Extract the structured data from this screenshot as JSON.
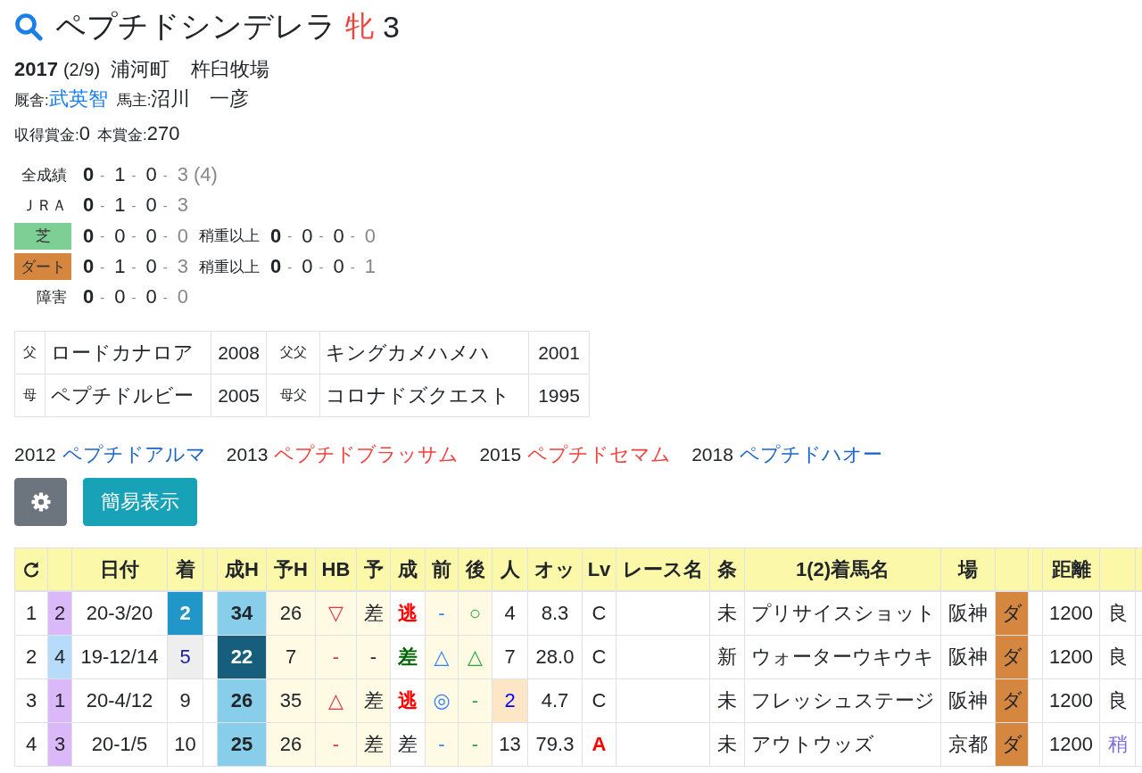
{
  "horse": {
    "name": "ペプチドシンデレラ",
    "sex": "牝",
    "age": "3"
  },
  "profile": {
    "birth_year": "2017",
    "birth_date": "(2/9)",
    "birthplace": "浦河町",
    "breeder": "杵臼牧場",
    "trainer_label": "厩舎:",
    "trainer": "武英智",
    "owner_label": "馬主:",
    "owner": "沼川　一彦",
    "prizes": [
      {
        "label": "収得賞金:",
        "value": "0"
      },
      {
        "label": "本賞金:",
        "value": "270"
      }
    ]
  },
  "records": [
    {
      "label": "全成績",
      "kind": "plain",
      "counts": [
        "0",
        "1",
        "0",
        "3"
      ],
      "separator": "-",
      "total": "(4)"
    },
    {
      "label": "ＪＲＡ",
      "kind": "plain",
      "counts": [
        "0",
        "1",
        "0",
        "3"
      ],
      "separator": "-"
    },
    {
      "label": "芝",
      "kind": "tag",
      "color": "#7ecf96",
      "counts": [
        "0",
        "0",
        "0",
        "0"
      ],
      "separator": "-",
      "heavy": {
        "label": "稍重以上",
        "counts": [
          "0",
          "0",
          "0",
          "0"
        ],
        "separator": "-"
      }
    },
    {
      "label": "ダート",
      "kind": "tag",
      "color": "#d5873f",
      "counts": [
        "0",
        "1",
        "0",
        "3"
      ],
      "separator": "-",
      "heavy": {
        "label": "稍重以上",
        "counts": [
          "0",
          "0",
          "0",
          "1"
        ],
        "separator": "-"
      }
    },
    {
      "label": "障害",
      "kind": "plain",
      "counts": [
        "0",
        "0",
        "0",
        "0"
      ],
      "separator": "-"
    }
  ],
  "pedigree": [
    {
      "relation": "父",
      "name": "ロードカナロア",
      "year": "2008",
      "grand_relation": "父父",
      "grand_name": "キングカメハメハ",
      "grand_year": "2001"
    },
    {
      "relation": "母",
      "name": "ペプチドルビー",
      "year": "2005",
      "grand_relation": "母父",
      "grand_name": "コロナドズクエスト",
      "grand_year": "1995"
    }
  ],
  "siblings": [
    {
      "year": "2012",
      "name": "ペプチドアルマ",
      "color": "#1a64c8"
    },
    {
      "year": "2013",
      "name": "ペプチドブラッサム",
      "color": "#f2403a"
    },
    {
      "year": "2015",
      "name": "ペプチドセマム",
      "color": "#f2403a"
    },
    {
      "year": "2018",
      "name": "ペプチドハオー",
      "color": "#1a64c8"
    }
  ],
  "buttons": [
    {
      "kind": "settings",
      "color": "#6c757d"
    },
    {
      "kind": "text",
      "label": "簡易表示",
      "color": "#17a2b8"
    }
  ],
  "table": {
    "columns": [
      {
        "kind": "refresh"
      },
      {
        "kind": "blank"
      },
      {
        "kind": "label",
        "label": "日付"
      },
      {
        "kind": "label",
        "label": "着"
      },
      {
        "kind": "blank"
      },
      {
        "kind": "label",
        "label": "成H"
      },
      {
        "kind": "label",
        "label": "予H"
      },
      {
        "kind": "label",
        "label": "HB"
      },
      {
        "kind": "label",
        "label": "予"
      },
      {
        "kind": "label",
        "label": "成"
      },
      {
        "kind": "label",
        "label": "前"
      },
      {
        "kind": "label",
        "label": "後"
      },
      {
        "kind": "label",
        "label": "人"
      },
      {
        "kind": "label",
        "label": "オッ"
      },
      {
        "kind": "label",
        "label": "Lv"
      },
      {
        "kind": "label",
        "label": "レース名"
      },
      {
        "kind": "label",
        "label": "条"
      },
      {
        "kind": "label",
        "label": "1(2)着馬名"
      },
      {
        "kind": "label",
        "label": "場"
      },
      {
        "kind": "blank"
      },
      {
        "kind": "blank"
      },
      {
        "kind": "label",
        "label": "距離"
      },
      {
        "kind": "blank"
      },
      {
        "kind": "blank"
      }
    ],
    "rows": [
      {
        "cells": [
          {
            "kind": "text",
            "text": "1"
          },
          {
            "kind": "text",
            "text": "2",
            "background": {
              "color": "#dbb8f7"
            }
          },
          {
            "kind": "text",
            "text": "20-3/20"
          },
          {
            "kind": "strong",
            "text": "2",
            "background": {
              "color": "#2196c9"
            }
          },
          {
            "kind": "blank"
          },
          {
            "kind": "strong",
            "text": "34",
            "background": {
              "color": "#88ceea"
            }
          },
          {
            "kind": "text",
            "text": "26",
            "background": {
              "color": "#fefae4"
            }
          },
          {
            "kind": "text",
            "text": "▽",
            "color": "#dc3545",
            "background": {
              "color": "#fefae4"
            }
          },
          {
            "kind": "text",
            "text": "差",
            "background": {
              "color": "#fefae4"
            }
          },
          {
            "kind": "strong",
            "text": "逃",
            "color": "#ff0000"
          },
          {
            "kind": "text",
            "text": "-",
            "color": "#2f7fff",
            "background": {
              "color": "#fefae4"
            }
          },
          {
            "kind": "text",
            "text": "○",
            "color": "#28a745",
            "background": {
              "color": "#fefae4"
            }
          },
          {
            "kind": "text",
            "text": "4"
          },
          {
            "kind": "text",
            "text": "8.3"
          },
          {
            "kind": "text",
            "text": "C"
          },
          {
            "kind": "blank"
          },
          {
            "kind": "text",
            "text": "未"
          },
          {
            "kind": "text",
            "text": "プリサイスショット"
          },
          {
            "kind": "text",
            "text": "阪神"
          },
          {
            "kind": "text",
            "text": "ダ",
            "background": {
              "color": "#d5873f"
            }
          },
          {
            "kind": "blank"
          },
          {
            "kind": "text",
            "text": "1200"
          },
          {
            "kind": "text",
            "text": "良"
          },
          {
            "kind": "blank"
          }
        ]
      },
      {
        "cells": [
          {
            "kind": "text",
            "text": "2"
          },
          {
            "kind": "text",
            "text": "4",
            "background": {
              "color": "#b6dbfb"
            }
          },
          {
            "kind": "text",
            "text": "19-12/14"
          },
          {
            "kind": "text",
            "text": "5",
            "color": "#1c1ca0",
            "background": {
              "color": "#eeeeee"
            }
          },
          {
            "kind": "blank"
          },
          {
            "kind": "strong",
            "text": "22",
            "background": {
              "color": "#165e7c"
            }
          },
          {
            "kind": "text",
            "text": "7",
            "background": {
              "color": "#fefae4"
            }
          },
          {
            "kind": "text",
            "text": "-",
            "color": "#dc3545",
            "background": {
              "color": "#fefae4"
            }
          },
          {
            "kind": "text",
            "text": "-",
            "background": {
              "color": "#fefae4"
            }
          },
          {
            "kind": "strong",
            "text": "差",
            "color": "#006400"
          },
          {
            "kind": "text",
            "text": "△",
            "color": "#2f7fff",
            "background": {
              "color": "#fefae4"
            }
          },
          {
            "kind": "text",
            "text": "△",
            "color": "#28a745",
            "background": {
              "color": "#fefae4"
            }
          },
          {
            "kind": "text",
            "text": "7"
          },
          {
            "kind": "text",
            "text": "28.0"
          },
          {
            "kind": "text",
            "text": "C"
          },
          {
            "kind": "blank"
          },
          {
            "kind": "text",
            "text": "新"
          },
          {
            "kind": "text",
            "text": "ウォーターウキウキ"
          },
          {
            "kind": "text",
            "text": "阪神"
          },
          {
            "kind": "text",
            "text": "ダ",
            "background": {
              "color": "#d5873f"
            }
          },
          {
            "kind": "blank"
          },
          {
            "kind": "text",
            "text": "1200"
          },
          {
            "kind": "text",
            "text": "良"
          },
          {
            "kind": "blank"
          }
        ]
      },
      {
        "cells": [
          {
            "kind": "text",
            "text": "3"
          },
          {
            "kind": "text",
            "text": "1",
            "background": {
              "color": "#dbb8f7"
            }
          },
          {
            "kind": "text",
            "text": "20-4/12"
          },
          {
            "kind": "text",
            "text": "9"
          },
          {
            "kind": "blank"
          },
          {
            "kind": "strong",
            "text": "26",
            "background": {
              "color": "#88ceea"
            }
          },
          {
            "kind": "text",
            "text": "35",
            "background": {
              "color": "#fefae4"
            }
          },
          {
            "kind": "text",
            "text": "△",
            "color": "#dc3545",
            "background": {
              "color": "#fefae4"
            }
          },
          {
            "kind": "text",
            "text": "差",
            "background": {
              "color": "#fefae4"
            }
          },
          {
            "kind": "strong",
            "text": "逃",
            "color": "#ff0000"
          },
          {
            "kind": "text",
            "text": "◎",
            "color": "#2f7fff",
            "background": {
              "color": "#fefae4"
            }
          },
          {
            "kind": "text",
            "text": "-",
            "color": "#28a745",
            "background": {
              "color": "#fefae4"
            }
          },
          {
            "kind": "text",
            "text": "2",
            "color": "#0000ff",
            "background": {
              "color": "#fde6c6"
            }
          },
          {
            "kind": "text",
            "text": "4.7"
          },
          {
            "kind": "text",
            "text": "C"
          },
          {
            "kind": "blank"
          },
          {
            "kind": "text",
            "text": "未"
          },
          {
            "kind": "text",
            "text": "フレッシュステージ"
          },
          {
            "kind": "text",
            "text": "阪神"
          },
          {
            "kind": "text",
            "text": "ダ",
            "background": {
              "color": "#d5873f"
            }
          },
          {
            "kind": "blank"
          },
          {
            "kind": "text",
            "text": "1200"
          },
          {
            "kind": "text",
            "text": "良"
          },
          {
            "kind": "blank"
          }
        ]
      },
      {
        "cells": [
          {
            "kind": "text",
            "text": "4"
          },
          {
            "kind": "text",
            "text": "3",
            "background": {
              "color": "#dbb8f7"
            }
          },
          {
            "kind": "text",
            "text": "20-1/5"
          },
          {
            "kind": "text",
            "text": "10"
          },
          {
            "kind": "blank"
          },
          {
            "kind": "strong",
            "text": "25",
            "background": {
              "color": "#88ceea"
            }
          },
          {
            "kind": "text",
            "text": "26",
            "background": {
              "color": "#fefae4"
            }
          },
          {
            "kind": "text",
            "text": "-",
            "color": "#dc3545",
            "background": {
              "color": "#fefae4"
            }
          },
          {
            "kind": "text",
            "text": "差",
            "background": {
              "color": "#fefae4"
            }
          },
          {
            "kind": "text",
            "text": "差"
          },
          {
            "kind": "text",
            "text": "-",
            "color": "#2f7fff",
            "background": {
              "color": "#fefae4"
            }
          },
          {
            "kind": "text",
            "text": "-",
            "color": "#28a745",
            "background": {
              "color": "#fefae4"
            }
          },
          {
            "kind": "text",
            "text": "13"
          },
          {
            "kind": "text",
            "text": "79.3"
          },
          {
            "kind": "strong",
            "text": "A",
            "color": "#ff0000"
          },
          {
            "kind": "blank"
          },
          {
            "kind": "text",
            "text": "未"
          },
          {
            "kind": "text",
            "text": "アウトウッズ"
          },
          {
            "kind": "text",
            "text": "京都"
          },
          {
            "kind": "text",
            "text": "ダ",
            "background": {
              "color": "#d5873f"
            }
          },
          {
            "kind": "blank"
          },
          {
            "kind": "text",
            "text": "1200"
          },
          {
            "kind": "text",
            "text": "稍",
            "color": "#7b6ce6"
          },
          {
            "kind": "blank"
          }
        ]
      }
    ]
  }
}
